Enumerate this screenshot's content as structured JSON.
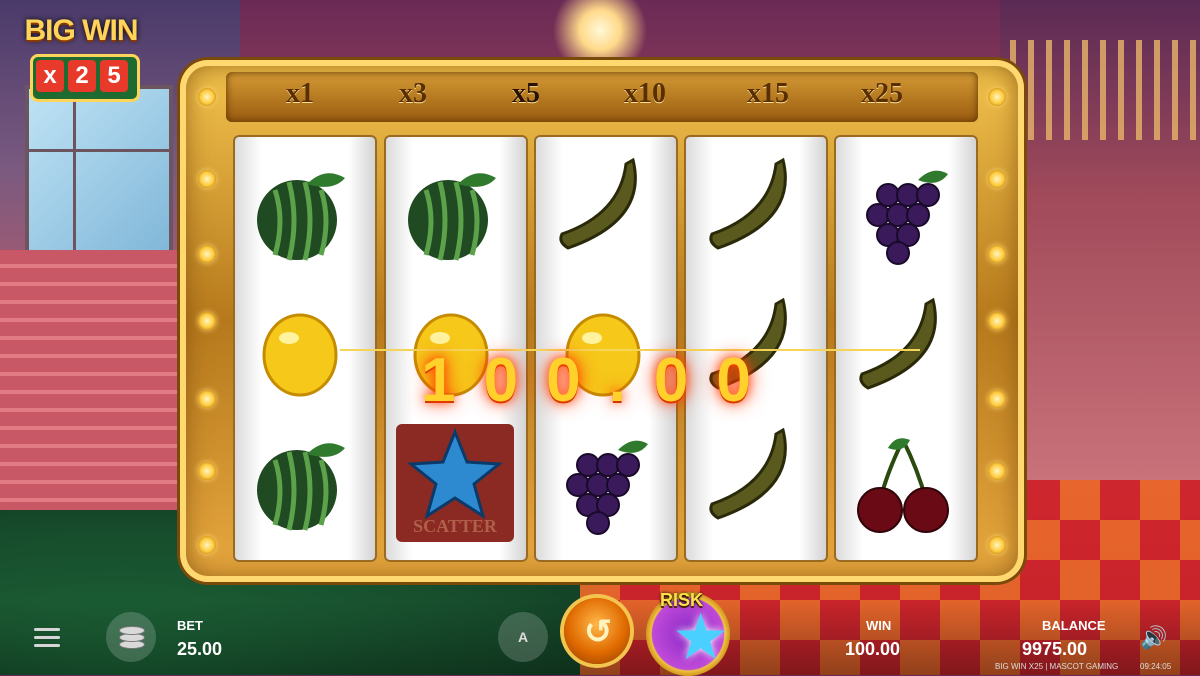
{
  "logo": {
    "title": "BIG WIN",
    "digits": [
      "x",
      "2",
      "5"
    ]
  },
  "multipliers": [
    {
      "label": "x1",
      "active": false
    },
    {
      "label": "x3",
      "active": false
    },
    {
      "label": "x5",
      "active": true
    },
    {
      "label": "x10",
      "active": false
    },
    {
      "label": "x15",
      "active": false
    },
    {
      "label": "x25",
      "active": false
    }
  ],
  "reels": [
    [
      "watermelon-icon",
      "lemon-icon",
      "watermelon-icon"
    ],
    [
      "watermelon-icon",
      "lemon-icon",
      "scatter-star-icon"
    ],
    [
      "banana-icon",
      "lemon-icon",
      "grapes-icon"
    ],
    [
      "banana-icon",
      "banana-icon",
      "banana-icon"
    ],
    [
      "grapes-icon",
      "banana-icon",
      "cherries-icon"
    ]
  ],
  "scatter_label": "SCATTER",
  "win_display": "100.00",
  "bottom_bar": {
    "bet_label": "BET",
    "bet_value": "25.00",
    "auto_label": "A",
    "risk_label": "RISK",
    "win_label": "WIN",
    "win_value": "100.00",
    "balance_label": "BALANCE",
    "balance_value": "9975.00"
  },
  "footer": {
    "game_info": "BIG WIN X25 | MASCOT GAMING",
    "clock": "09:24:05"
  },
  "colors": {
    "gold": "#f3c44e",
    "win_text": "#ffd12a",
    "risk_purple": "#8a2ac8"
  }
}
